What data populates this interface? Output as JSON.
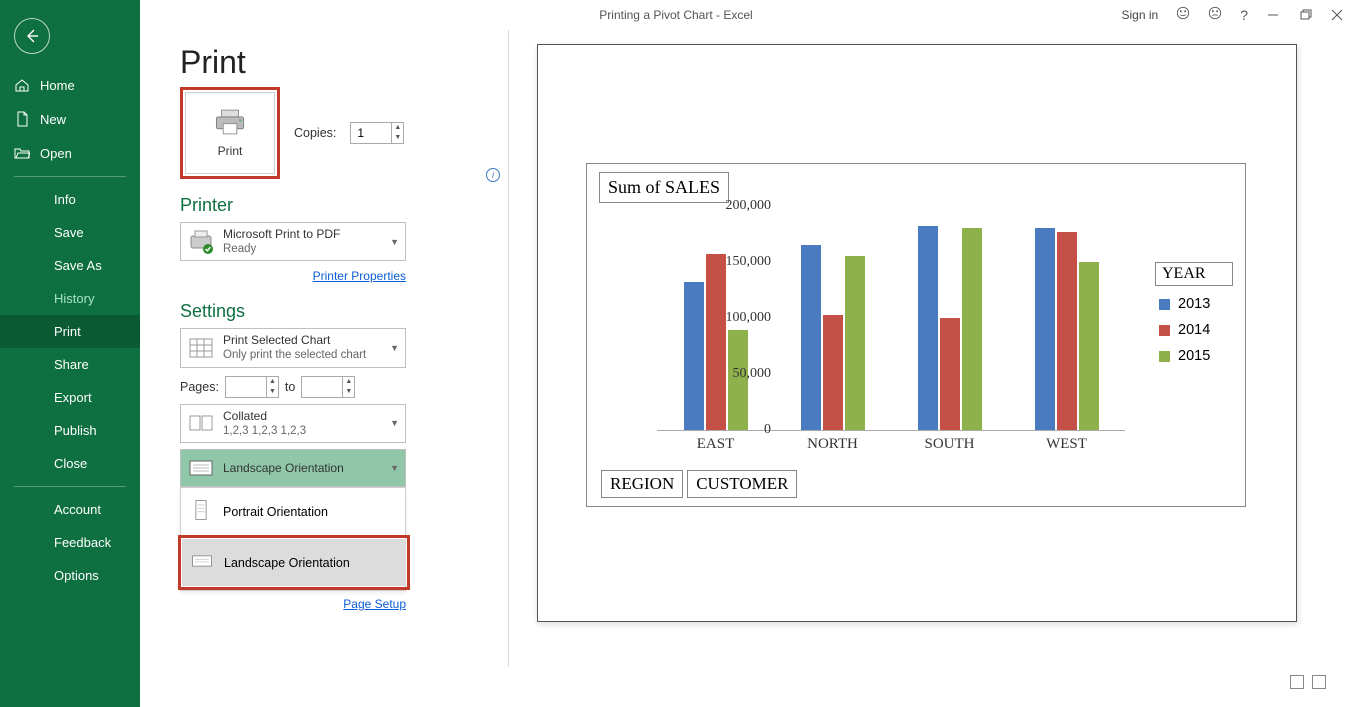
{
  "titlebar": {
    "title": "Printing a Pivot Chart  -  Excel",
    "signin": "Sign in"
  },
  "sidebar": {
    "items_top": [
      {
        "label": "Home"
      },
      {
        "label": "New"
      },
      {
        "label": "Open"
      }
    ],
    "items_mid": [
      {
        "label": "Info"
      },
      {
        "label": "Save"
      },
      {
        "label": "Save As"
      },
      {
        "label": "History"
      },
      {
        "label": "Print"
      },
      {
        "label": "Share"
      },
      {
        "label": "Export"
      },
      {
        "label": "Publish"
      },
      {
        "label": "Close"
      }
    ],
    "items_bot": [
      {
        "label": "Account"
      },
      {
        "label": "Feedback"
      },
      {
        "label": "Options"
      }
    ]
  },
  "print": {
    "heading": "Print",
    "print_btn": "Print",
    "copies_label": "Copies:",
    "copies_value": "1",
    "printer_heading": "Printer",
    "printer_name": "Microsoft Print to PDF",
    "printer_status": "Ready",
    "printer_props": "Printer Properties",
    "settings_heading": "Settings",
    "scope_title": "Print Selected Chart",
    "scope_sub": "Only print the selected chart",
    "pages_label": "Pages:",
    "to_label": "to",
    "collated_title": "Collated",
    "collated_sub": "1,2,3    1,2,3    1,2,3",
    "orientation_current": "Landscape Orientation",
    "orientation_options": {
      "portrait": "Portrait Orientation",
      "landscape": "Landscape Orientation"
    },
    "page_setup": "Page Setup"
  },
  "chart_data": {
    "type": "bar",
    "title": "Sum of SALES",
    "categories": [
      "EAST",
      "NORTH",
      "SOUTH",
      "WEST"
    ],
    "series": [
      {
        "name": "2013",
        "values": [
          132000,
          165000,
          182000,
          180000
        ],
        "color": "#4a7ac0"
      },
      {
        "name": "2014",
        "values": [
          157000,
          103000,
          100000,
          177000
        ],
        "color": "#c55048"
      },
      {
        "name": "2015",
        "values": [
          89000,
          155000,
          180000,
          150000
        ],
        "color": "#8fb14b"
      }
    ],
    "yticks": [
      "0",
      "50,000",
      "100,000",
      "150,000",
      "200,000"
    ],
    "ylim": [
      0,
      200000
    ],
    "legend_title": "YEAR",
    "axis_boxes": [
      "REGION",
      "CUSTOMER"
    ]
  }
}
